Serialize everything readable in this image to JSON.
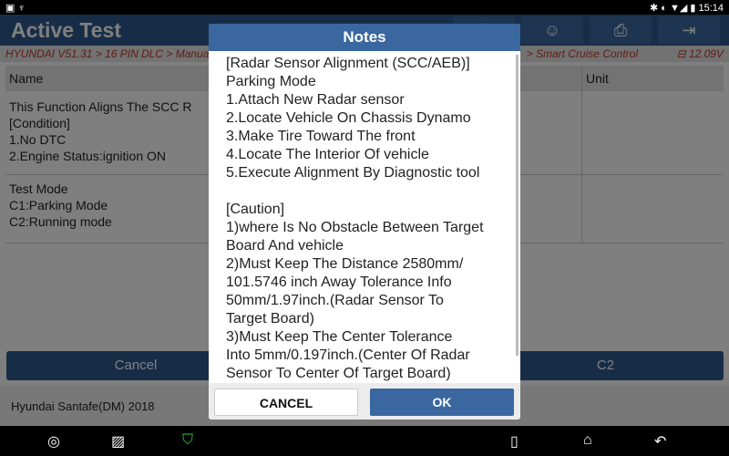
{
  "status_bar": {
    "time": "15:14"
  },
  "header": {
    "title": "Active Test"
  },
  "breadcrumb": {
    "path": "HYUNDAI V51.31 > 16 PIN DLC > Manua",
    "tail": "> Smart Cruise Control",
    "voltage": "12.09V"
  },
  "table": {
    "headers": [
      "Name",
      "Unit"
    ],
    "rows": [
      [
        "This Function Aligns The SCC R",
        "[Condition]",
        "1.No DTC",
        "2.Engine Status:ignition ON"
      ],
      [
        "Test Mode",
        "C1:Parking Mode",
        "C2:Running mode"
      ]
    ]
  },
  "buttons": {
    "cancel": "Cancel",
    "c2": "C2"
  },
  "footer": {
    "vehicle": "Hyundai Santafe(DM) 2018"
  },
  "dialog": {
    "title": "Notes",
    "lines": [
      "[Radar Sensor Alignment (SCC/AEB)]",
      "Parking Mode",
      "1.Attach New Radar sensor",
      "2.Locate Vehicle On Chassis Dynamo",
      "3.Make Tire Toward The front",
      "4.Locate The Interior Of vehicle",
      "5.Execute Alignment By Diagnostic tool",
      "",
      "[Caution]",
      "1)where Is No Obstacle Between Target",
      "Board And vehicle",
      "2)Must Keep The Distance 2580mm/",
      "101.5746 inch Away Tolerance Info",
      "50mm/1.97inch.(Radar Sensor To",
      "Target Board)",
      "3)Must Keep The Center Tolerance",
      "Into 5mm/0.197inch.(Center Of Radar",
      "Sensor To Center Of Target Board)"
    ],
    "cancel": "CANCEL",
    "ok": "OK"
  }
}
